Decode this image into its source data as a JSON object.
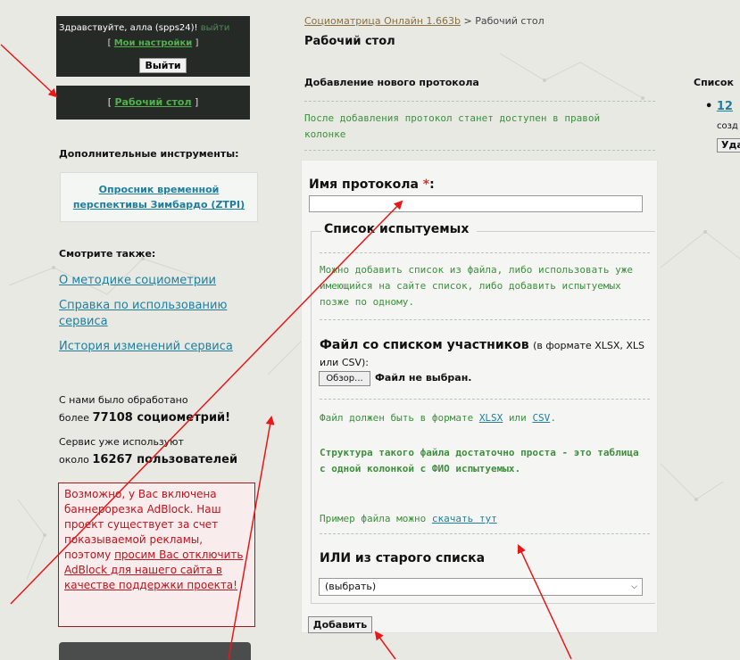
{
  "user_box": {
    "greeting": "Здравствуйте, алла (spps24)!",
    "greeting_suffix": "выйти",
    "settings_link": "Мои настройки",
    "logout_button": "Выйти"
  },
  "desk_box": {
    "link": "Рабочий стол"
  },
  "tools": {
    "title": "Дополнительные инструменты:",
    "ztpi_line1": "Опросник временной",
    "ztpi_line2": "перспективы Зимбардо (ZTPI)"
  },
  "see_also": {
    "title": "Смотрите также:",
    "links": [
      "О методике социометрии",
      "Справка по использованию сервиса",
      "История изменений сервиса"
    ]
  },
  "stats": {
    "processed_prefix": "С нами было обработано",
    "processed_more": "более",
    "processed_value": "77108 социометрий!",
    "users_prefix": "Сервис уже используют",
    "users_about": "около",
    "users_value": "16267 пользователей"
  },
  "adblock": {
    "text1": "Возможно, у Вас включена баннерорезка AdBlock. Наш проект существует за счет показываемой рекламы, поэтому ",
    "link": "просим Вас отключить AdBlock для нашего сайта в качестве поддержки проекта!"
  },
  "breadcrumb": {
    "link": "Социоматрица Онлайн 1.663b",
    "sep": " > ",
    "current": "Рабочий стол"
  },
  "page_title": "Рабочий стол",
  "new_protocol": {
    "title": "Добавление нового протокола",
    "info": "После добавления протокол станет доступен в правой колонке"
  },
  "form": {
    "name_label": "Имя протокола",
    "required_mark": "*",
    "colon": ":",
    "name_value": "",
    "subjects_legend": "Список испытуемых",
    "subjects_info": "Можно добавить список из файла, либо использовать уже имеющийся на сайте список, либо добавить испытуемых позже по одному.",
    "file_label": "Файл со списком участников",
    "file_format_note": "(в формате XLSX, XLS или CSV):",
    "browse_button": "Обзор...",
    "no_file": "Файл не выбран.",
    "format_prefix": "Файл должен быть в формате ",
    "format_xlsx": "XLSX",
    "format_or": " или ",
    "format_csv": "CSV",
    "format_end": ".",
    "structure_info": "Структура такого файла достаточно проста - это таблица с одной колонкой с ФИО испытуемых.",
    "example_prefix": "Пример файла можно ",
    "example_link": "скачать тут",
    "old_list_label": "ИЛИ из старого списка",
    "select_value": "(выбрать)",
    "add_button": "Добавить"
  },
  "right_column": {
    "title": "Список",
    "item": "12",
    "created": "созд",
    "delete_button": "Уда"
  },
  "colors": {
    "link": "#1d7f9f",
    "green_text": "#3d8f3d",
    "dark_box": "#262a27",
    "adblock_red": "#c2121c",
    "arrow": "#e81818"
  }
}
